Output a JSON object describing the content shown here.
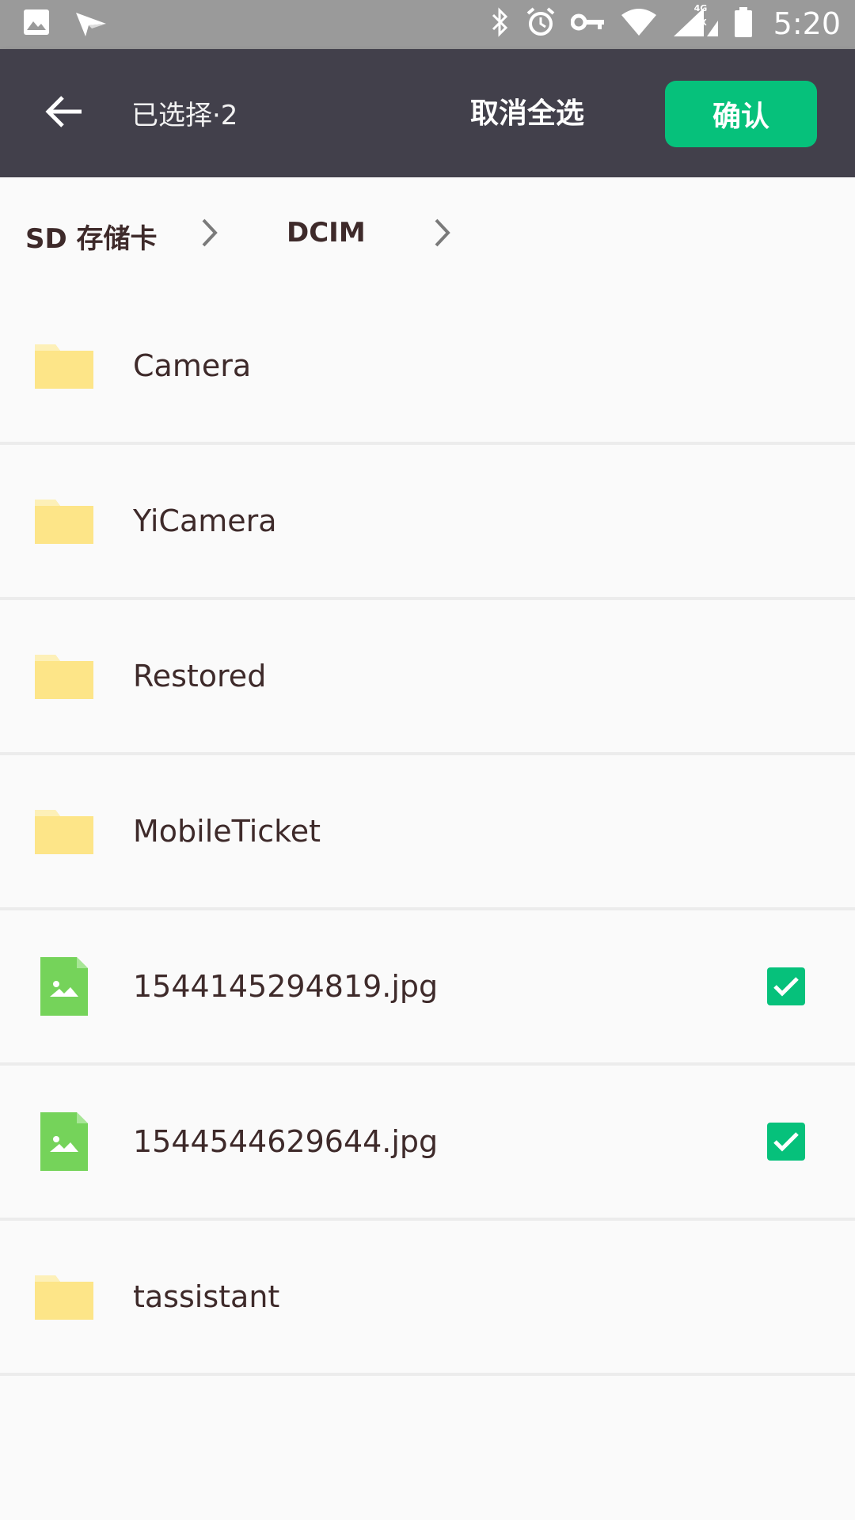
{
  "status_bar": {
    "time": "5:20",
    "network_label_top": "4G",
    "network_label_bottom": "1X",
    "left_icons": [
      "image-icon",
      "send-icon"
    ],
    "right_icons": [
      "bluetooth-icon",
      "alarm-icon",
      "key-icon",
      "wifi-icon",
      "signal-icon",
      "battery-icon"
    ]
  },
  "toolbar": {
    "selected_label": "已选择·2",
    "deselect_all_label": "取消全选",
    "confirm_label": "确认"
  },
  "breadcrumb": {
    "items": [
      "SD 存储卡",
      "DCIM"
    ]
  },
  "files": [
    {
      "name": "Camera",
      "type": "folder",
      "checked": false
    },
    {
      "name": "YiCamera",
      "type": "folder",
      "checked": false
    },
    {
      "name": "Restored",
      "type": "folder",
      "checked": false
    },
    {
      "name": "MobileTicket",
      "type": "folder",
      "checked": false
    },
    {
      "name": "1544145294819.jpg",
      "type": "image",
      "checked": true
    },
    {
      "name": "1544544629644.jpg",
      "type": "image",
      "checked": true
    },
    {
      "name": "tassistant",
      "type": "folder",
      "checked": false
    }
  ],
  "colors": {
    "toolbar_bg": "#42404b",
    "accent_green": "#06c17b",
    "folder_yellow": "#fde588",
    "image_green": "#75d35a",
    "text_dark": "#3e2a2a"
  }
}
